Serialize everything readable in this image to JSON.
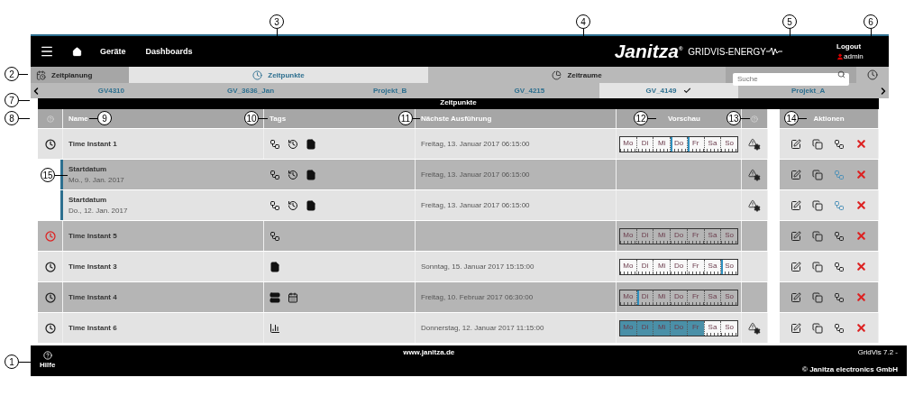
{
  "callouts": [
    {
      "label": "3"
    },
    {
      "label": "4"
    },
    {
      "label": "5"
    },
    {
      "label": "6"
    },
    {
      "label": "2"
    },
    {
      "label": "7"
    },
    {
      "label": "8"
    },
    {
      "label": "9"
    },
    {
      "label": "10"
    },
    {
      "label": "11"
    },
    {
      "label": "12"
    },
    {
      "label": "13"
    },
    {
      "label": "14"
    },
    {
      "label": "15"
    },
    {
      "label": "1"
    }
  ],
  "top_bar": {
    "nav": [
      "Geräte",
      "Dashboards"
    ],
    "logo": "Janitza",
    "logo_mark": "®",
    "product": "GRIDVIS-ENERGY",
    "logout": "Logout",
    "user": "admin"
  },
  "tabs": [
    {
      "label": "Zeitplanung",
      "kind": "section",
      "selected": false
    },
    {
      "label": "Zeitpunkte",
      "kind": "tab",
      "selected": true
    },
    {
      "label": "Zeitraume",
      "kind": "tab",
      "selected": false
    }
  ],
  "search": {
    "placeholder": "Suche"
  },
  "projects": [
    {
      "label": "GV4310",
      "selected": false
    },
    {
      "label": "GV_3636_Jan",
      "selected": false
    },
    {
      "label": "Projekt_B",
      "selected": false
    },
    {
      "label": "GV_4215",
      "selected": false
    },
    {
      "label": "GV_4149",
      "selected": true
    },
    {
      "label": "Projekt_A",
      "selected": false
    }
  ],
  "panel_title": "Zeitpunkte",
  "table": {
    "columns": [
      "Name",
      "Tags",
      "Nächste Ausführung",
      "Vorschau",
      "Aktionen"
    ],
    "rows": [
      {
        "kind": "instant",
        "name": "Time Instant 1",
        "alert": false,
        "tags": [
          {
            "kind": "flow"
          },
          {
            "kind": "history"
          },
          {
            "kind": "document"
          }
        ],
        "next_run": "Freitag, 13. Januar 2017 06:15:00",
        "preview": [
          {
            "label": "Mo",
            "marker": false,
            "filled": false
          },
          {
            "label": "Di",
            "marker": false,
            "filled": false
          },
          {
            "label": "Mi",
            "marker": false,
            "filled": false
          },
          {
            "label": "Do",
            "marker": true,
            "filled": false
          },
          {
            "label": "Fr",
            "marker": true,
            "filled": false
          },
          {
            "label": "Sa",
            "marker": false,
            "filled": false
          },
          {
            "label": "So",
            "marker": false,
            "filled": false
          }
        ],
        "warning": true
      },
      {
        "kind": "start",
        "name": "Startdatum",
        "date": "Mo., 9. Jan. 2017",
        "tags": [
          {
            "kind": "flow"
          },
          {
            "kind": "history"
          },
          {
            "kind": "document"
          }
        ],
        "next_run": "Freitag, 13. Januar 2017 06:15:00",
        "warning": true
      },
      {
        "kind": "start",
        "name": "Startdatum",
        "date": "Do., 12. Jan. 2017",
        "tags": [
          {
            "kind": "flow"
          },
          {
            "kind": "history"
          },
          {
            "kind": "document"
          }
        ],
        "next_run": "Freitag, 13. Januar 2017 06:15:00",
        "warning": true
      },
      {
        "kind": "instant",
        "name": "Time Instant 5",
        "alert": true,
        "tags": [
          {
            "kind": "flow"
          }
        ],
        "preview": [
          {
            "label": "Mo",
            "marker": false,
            "filled": false
          },
          {
            "label": "Di",
            "marker": false,
            "filled": false
          },
          {
            "label": "Mi",
            "marker": false,
            "filled": false
          },
          {
            "label": "Do",
            "marker": false,
            "filled": false
          },
          {
            "label": "Fr",
            "marker": false,
            "filled": false
          },
          {
            "label": "Sa",
            "marker": false,
            "filled": false
          },
          {
            "label": "So",
            "marker": false,
            "filled": false
          }
        ],
        "warning": false
      },
      {
        "kind": "instant",
        "name": "Time Instant 3",
        "alert": false,
        "tags": [
          {
            "kind": "document"
          }
        ],
        "next_run": "Sonntag, 15. Januar 2017 15:15:00",
        "preview": [
          {
            "label": "Mo",
            "marker": false,
            "filled": false
          },
          {
            "label": "Di",
            "marker": false,
            "filled": false
          },
          {
            "label": "Mi",
            "marker": false,
            "filled": false
          },
          {
            "label": "Do",
            "marker": false,
            "filled": false
          },
          {
            "label": "Fr",
            "marker": false,
            "filled": false
          },
          {
            "label": "Sa",
            "marker": false,
            "filled": false
          },
          {
            "label": "So",
            "marker": true,
            "filled": false
          }
        ],
        "warning": false
      },
      {
        "kind": "instant",
        "name": "Time Instant 4",
        "alert": false,
        "tags": [
          {
            "kind": "server"
          },
          {
            "kind": "calendar"
          }
        ],
        "next_run": "Freitag, 10. Februar 2017 06:30:00",
        "preview": [
          {
            "label": "Mo",
            "marker": false,
            "filled": false
          },
          {
            "label": "Di",
            "marker": true,
            "filled": false
          },
          {
            "label": "Mi",
            "marker": false,
            "filled": false
          },
          {
            "label": "Do",
            "marker": false,
            "filled": false
          },
          {
            "label": "Fr",
            "marker": false,
            "filled": false
          },
          {
            "label": "Sa",
            "marker": false,
            "filled": false
          },
          {
            "label": "So",
            "marker": false,
            "filled": false
          }
        ],
        "warning": false
      },
      {
        "kind": "instant",
        "name": "Time Instant 6",
        "alert": false,
        "tags": [
          {
            "kind": "chart"
          }
        ],
        "next_run": "Donnerstag, 12. Januar 2017 11:15:00",
        "preview": [
          {
            "label": "Mo",
            "marker": false,
            "filled": true
          },
          {
            "label": "Di",
            "marker": false,
            "filled": true
          },
          {
            "label": "Mi",
            "marker": false,
            "filled": true
          },
          {
            "label": "Do",
            "marker": false,
            "filled": true
          },
          {
            "label": "Fr",
            "marker": false,
            "filled": true
          },
          {
            "label": "Sa",
            "marker": false,
            "filled": false
          },
          {
            "label": "So",
            "marker": false,
            "filled": false
          }
        ],
        "warning": true
      }
    ]
  },
  "footer": {
    "help": "Hilfe",
    "link": "www.janitza.de",
    "version": "GridVis 7.2 -",
    "copyright": "© Janitza electronics GmbH"
  }
}
